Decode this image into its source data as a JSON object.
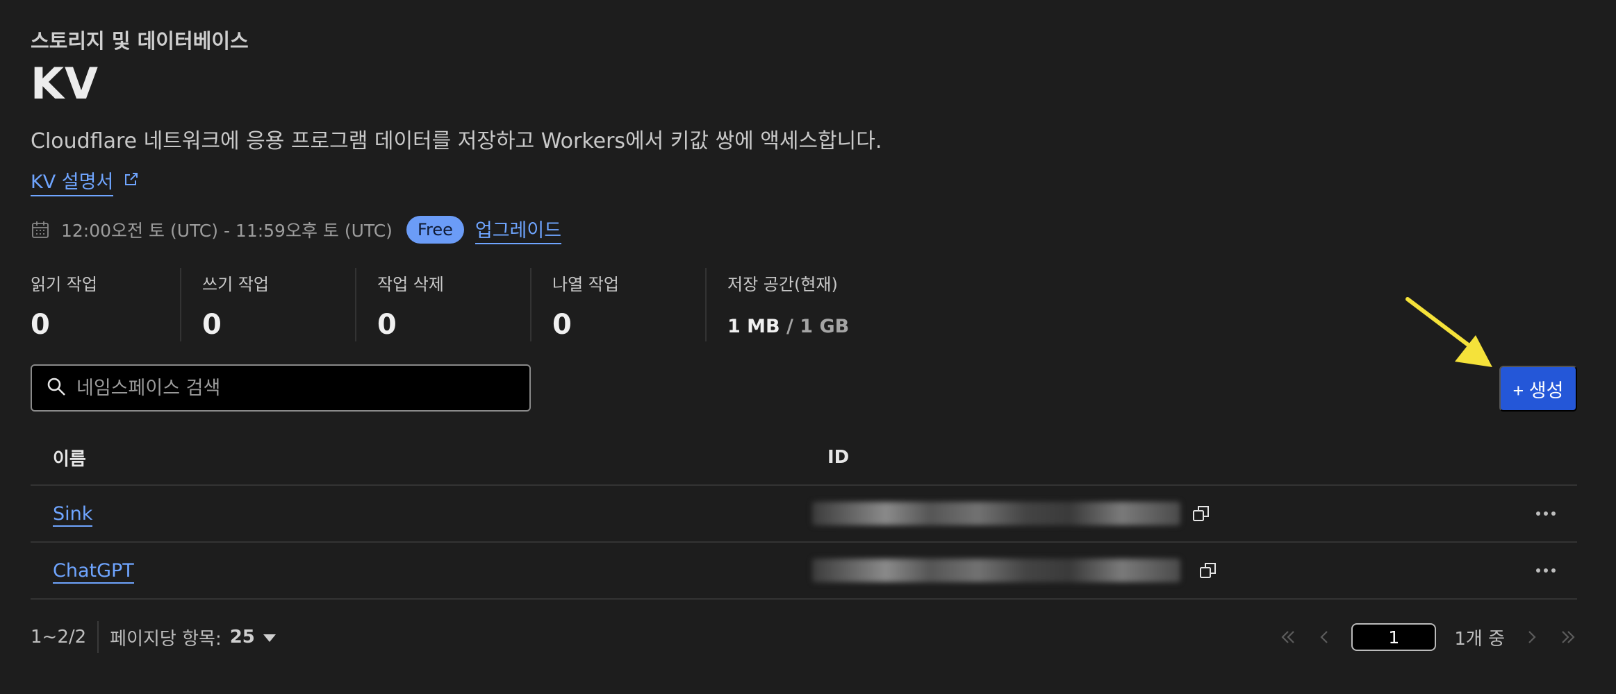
{
  "header": {
    "breadcrumb": "스토리지 및 데이터베이스",
    "title": "KV",
    "description": "Cloudflare 네트워크에 응용 프로그램 데이터를 저장하고 Workers에서 키값 쌍에 액세스합니다.",
    "doc_link": "KV 설명서"
  },
  "period": {
    "range": "12:00오전 토 (UTC) - 11:59오후 토 (UTC)",
    "plan_badge": "Free",
    "upgrade_label": "업그레이드"
  },
  "metrics": [
    {
      "label": "읽기 작업",
      "value": "0"
    },
    {
      "label": "쓰기 작업",
      "value": "0"
    },
    {
      "label": "작업 삭제",
      "value": "0"
    },
    {
      "label": "나열 작업",
      "value": "0"
    },
    {
      "label": "저장 공간(현재)",
      "used": "1 MB",
      "limit": "/ 1 GB"
    }
  ],
  "search": {
    "placeholder": "네임스페이스 검색",
    "value": ""
  },
  "create_button": {
    "label": "+ 생성"
  },
  "table": {
    "headers": {
      "name": "이름",
      "id": "ID"
    },
    "rows": [
      {
        "name": "Sink"
      },
      {
        "name": "ChatGPT"
      }
    ]
  },
  "footer": {
    "range": "1~2/2",
    "per_page_label": "페이지당 항목:",
    "per_page_value": "25",
    "current_page": "1",
    "total_pages_label": "1개 중"
  },
  "colors": {
    "accent": "#2457d8",
    "link": "#6fa5ff",
    "badge": "#6b9cf7",
    "annotation_arrow": "#f5e23a"
  }
}
